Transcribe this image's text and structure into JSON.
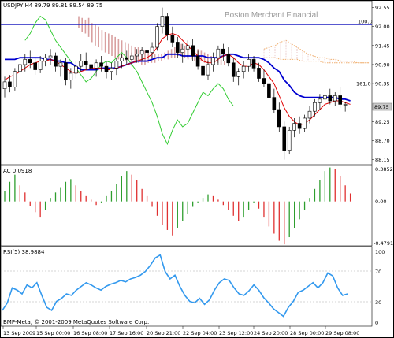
{
  "main": {
    "symbol_caption": "USDJPY,H4  89.79 89.81 89.54 89.75",
    "watermark": "Boston Merchant Financial",
    "current_price_label": "89.75",
    "price_ticks": [
      "92.55",
      "92.00",
      "91.45",
      "90.90",
      "90.35",
      "89.75",
      "89.25",
      "88.70",
      "88.15"
    ],
    "fib_labels": {
      "upper": "100.0",
      "lower": "161.0"
    },
    "colors": {
      "bull_candle": "#ffffff",
      "bear_candle": "#000000",
      "kijun": "#0000d0",
      "tenkan": "#e00000",
      "chikou": "#33cc33",
      "cloud": "#d9a0a0",
      "cloud_future": "#f0b070",
      "fib": "#2020c0"
    },
    "candles": [
      {
        "o": 90.2,
        "h": 90.55,
        "l": 89.95,
        "c": 90.4
      },
      {
        "o": 90.4,
        "h": 90.6,
        "l": 90.1,
        "c": 90.25
      },
      {
        "o": 90.25,
        "h": 90.8,
        "l": 90.15,
        "c": 90.7
      },
      {
        "o": 90.7,
        "h": 91.0,
        "l": 90.5,
        "c": 90.9
      },
      {
        "o": 90.9,
        "h": 91.2,
        "l": 90.7,
        "c": 91.05
      },
      {
        "o": 91.05,
        "h": 91.3,
        "l": 90.8,
        "c": 90.95
      },
      {
        "o": 90.95,
        "h": 91.1,
        "l": 90.6,
        "c": 90.75
      },
      {
        "o": 90.75,
        "h": 91.15,
        "l": 90.65,
        "c": 91.0
      },
      {
        "o": 91.0,
        "h": 91.2,
        "l": 90.85,
        "c": 91.1
      },
      {
        "o": 91.1,
        "h": 91.35,
        "l": 90.9,
        "c": 91.15
      },
      {
        "o": 91.15,
        "h": 91.25,
        "l": 90.7,
        "c": 90.85
      },
      {
        "o": 90.85,
        "h": 91.05,
        "l": 90.55,
        "c": 90.95
      },
      {
        "o": 90.95,
        "h": 91.1,
        "l": 90.3,
        "c": 90.45
      },
      {
        "o": 90.45,
        "h": 90.8,
        "l": 90.2,
        "c": 90.65
      },
      {
        "o": 90.65,
        "h": 91.0,
        "l": 90.5,
        "c": 90.85
      },
      {
        "o": 90.85,
        "h": 91.2,
        "l": 90.7,
        "c": 91.0
      },
      {
        "o": 91.0,
        "h": 91.25,
        "l": 90.75,
        "c": 90.9
      },
      {
        "o": 90.9,
        "h": 91.1,
        "l": 90.6,
        "c": 90.8
      },
      {
        "o": 90.8,
        "h": 91.05,
        "l": 90.55,
        "c": 90.95
      },
      {
        "o": 90.95,
        "h": 91.15,
        "l": 90.7,
        "c": 90.85
      },
      {
        "o": 90.85,
        "h": 91.0,
        "l": 90.5,
        "c": 90.7
      },
      {
        "o": 90.7,
        "h": 90.95,
        "l": 90.45,
        "c": 90.8
      },
      {
        "o": 90.8,
        "h": 91.1,
        "l": 90.6,
        "c": 91.0
      },
      {
        "o": 91.0,
        "h": 91.2,
        "l": 90.8,
        "c": 91.1
      },
      {
        "o": 91.1,
        "h": 91.3,
        "l": 90.9,
        "c": 91.05
      },
      {
        "o": 91.05,
        "h": 91.25,
        "l": 90.85,
        "c": 91.15
      },
      {
        "o": 91.15,
        "h": 91.35,
        "l": 90.95,
        "c": 91.2
      },
      {
        "o": 91.2,
        "h": 91.4,
        "l": 91.0,
        "c": 91.3
      },
      {
        "o": 91.3,
        "h": 91.5,
        "l": 91.05,
        "c": 91.25
      },
      {
        "o": 91.25,
        "h": 91.55,
        "l": 91.1,
        "c": 91.4
      },
      {
        "o": 91.4,
        "h": 92.1,
        "l": 91.3,
        "c": 92.0
      },
      {
        "o": 92.0,
        "h": 92.55,
        "l": 91.8,
        "c": 92.3
      },
      {
        "o": 92.3,
        "h": 92.4,
        "l": 91.6,
        "c": 91.75
      },
      {
        "o": 91.75,
        "h": 92.0,
        "l": 91.4,
        "c": 91.55
      },
      {
        "o": 91.55,
        "h": 91.7,
        "l": 91.1,
        "c": 91.25
      },
      {
        "o": 91.25,
        "h": 91.5,
        "l": 90.95,
        "c": 91.35
      },
      {
        "o": 91.35,
        "h": 91.6,
        "l": 91.1,
        "c": 91.45
      },
      {
        "o": 91.45,
        "h": 91.65,
        "l": 91.0,
        "c": 91.15
      },
      {
        "o": 91.15,
        "h": 91.3,
        "l": 90.75,
        "c": 90.85
      },
      {
        "o": 90.85,
        "h": 91.1,
        "l": 90.4,
        "c": 90.6
      },
      {
        "o": 90.6,
        "h": 91.0,
        "l": 90.45,
        "c": 90.9
      },
      {
        "o": 90.9,
        "h": 91.25,
        "l": 90.7,
        "c": 91.1
      },
      {
        "o": 91.1,
        "h": 91.45,
        "l": 90.9,
        "c": 91.35
      },
      {
        "o": 91.35,
        "h": 91.5,
        "l": 91.0,
        "c": 91.2
      },
      {
        "o": 91.2,
        "h": 91.4,
        "l": 90.85,
        "c": 90.95
      },
      {
        "o": 90.95,
        "h": 91.1,
        "l": 90.4,
        "c": 90.55
      },
      {
        "o": 90.55,
        "h": 90.8,
        "l": 90.3,
        "c": 90.7
      },
      {
        "o": 90.7,
        "h": 91.0,
        "l": 90.5,
        "c": 90.85
      },
      {
        "o": 90.85,
        "h": 91.2,
        "l": 90.7,
        "c": 91.05
      },
      {
        "o": 91.05,
        "h": 91.15,
        "l": 90.7,
        "c": 90.8
      },
      {
        "o": 90.8,
        "h": 90.95,
        "l": 90.4,
        "c": 90.5
      },
      {
        "o": 90.5,
        "h": 90.75,
        "l": 90.25,
        "c": 90.35
      },
      {
        "o": 90.35,
        "h": 90.5,
        "l": 89.85,
        "c": 89.95
      },
      {
        "o": 89.95,
        "h": 90.2,
        "l": 89.5,
        "c": 89.6
      },
      {
        "o": 89.6,
        "h": 89.8,
        "l": 88.95,
        "c": 89.1
      },
      {
        "o": 89.1,
        "h": 89.25,
        "l": 88.15,
        "c": 88.4
      },
      {
        "o": 88.4,
        "h": 89.1,
        "l": 88.3,
        "c": 89.0
      },
      {
        "o": 89.0,
        "h": 89.35,
        "l": 88.8,
        "c": 89.2
      },
      {
        "o": 89.2,
        "h": 89.4,
        "l": 88.9,
        "c": 89.05
      },
      {
        "o": 89.05,
        "h": 89.45,
        "l": 88.95,
        "c": 89.35
      },
      {
        "o": 89.35,
        "h": 89.7,
        "l": 89.2,
        "c": 89.55
      },
      {
        "o": 89.55,
        "h": 89.9,
        "l": 89.4,
        "c": 89.8
      },
      {
        "o": 89.8,
        "h": 90.05,
        "l": 89.6,
        "c": 89.9
      },
      {
        "o": 89.9,
        "h": 90.15,
        "l": 89.7,
        "c": 90.0
      },
      {
        "o": 90.0,
        "h": 90.2,
        "l": 89.75,
        "c": 89.85
      },
      {
        "o": 89.85,
        "h": 90.1,
        "l": 89.7,
        "c": 90.0
      },
      {
        "o": 90.0,
        "h": 90.25,
        "l": 89.65,
        "c": 89.75
      },
      {
        "o": 89.75,
        "h": 89.81,
        "l": 89.54,
        "c": 89.75
      }
    ],
    "kijun": [
      91.05,
      91.05,
      91.05,
      91.1,
      91.1,
      91.1,
      91.1,
      91.1,
      91.05,
      91.05,
      91.0,
      91.0,
      90.95,
      90.95,
      90.85,
      90.75,
      90.75,
      90.75,
      90.75,
      90.8,
      90.8,
      90.8,
      90.8,
      90.85,
      90.9,
      90.95,
      91.0,
      91.0,
      91.0,
      91.05,
      91.1,
      91.1,
      91.2,
      91.2,
      91.2,
      91.15,
      91.15,
      91.15,
      91.15,
      91.15,
      91.1,
      91.1,
      91.1,
      91.15,
      91.2,
      91.2,
      91.15,
      91.1,
      91.1,
      91.1,
      91.1,
      91.05,
      90.95,
      90.8,
      90.7,
      90.45,
      90.3,
      90.1,
      90.0,
      89.95,
      89.95,
      89.95,
      89.95,
      89.95,
      89.95,
      89.95,
      89.9,
      89.9,
      89.85
    ],
    "tenkan": [
      90.45,
      90.55,
      90.6,
      90.7,
      90.8,
      90.9,
      90.95,
      91.0,
      91.0,
      91.05,
      91.0,
      90.9,
      90.8,
      90.7,
      90.65,
      90.7,
      90.75,
      90.8,
      90.8,
      90.8,
      90.75,
      90.75,
      90.8,
      90.85,
      90.9,
      90.95,
      91.0,
      91.05,
      91.1,
      91.2,
      91.4,
      91.65,
      91.75,
      91.8,
      91.75,
      91.6,
      91.45,
      91.3,
      91.15,
      91.0,
      90.95,
      90.95,
      91.05,
      91.15,
      91.2,
      91.1,
      90.95,
      90.85,
      90.85,
      90.95,
      90.9,
      90.75,
      90.55,
      90.35,
      90.0,
      89.65,
      89.4,
      89.25,
      89.15,
      89.2,
      89.3,
      89.45,
      89.6,
      89.75,
      89.8,
      89.85,
      89.85,
      89.8,
      89.75
    ],
    "chikou": [
      91.6,
      91.8,
      92.1,
      92.3,
      92.2,
      91.9,
      91.6,
      91.4,
      91.2,
      91.0,
      90.8,
      90.6,
      90.4,
      90.5,
      90.7,
      90.9,
      91.0,
      90.95,
      91.1,
      91.25,
      91.1,
      90.9,
      90.7,
      90.4,
      90.1,
      89.8,
      89.4,
      88.9,
      88.6,
      89.0,
      89.3,
      89.1,
      89.2,
      89.5,
      89.8,
      90.1,
      90.0,
      90.2,
      90.35,
      90.2,
      89.9,
      89.7
    ],
    "cloud_top": [
      92.3,
      92.25,
      92.2,
      92.25,
      92.1,
      92.05,
      92.0,
      91.9,
      91.85,
      91.8,
      91.75,
      91.7,
      91.65,
      91.6,
      91.55,
      91.5,
      91.45,
      91.4,
      91.4,
      91.35,
      91.3,
      91.3,
      91.25,
      91.2,
      91.2,
      91.2,
      91.25,
      91.3,
      91.35,
      91.4,
      91.45,
      91.5,
      91.45,
      91.4,
      91.35,
      91.3,
      91.35,
      91.3,
      91.25,
      91.2,
      91.15,
      91.1,
      91.1,
      91.05,
      91.0
    ],
    "cloud_bottom": [
      91.95,
      91.85,
      91.8,
      91.7,
      91.55,
      91.45,
      91.4,
      91.3,
      91.25,
      91.2,
      91.15,
      91.1,
      91.05,
      91.05,
      91.0,
      91.0,
      90.95,
      90.95,
      90.95,
      90.9,
      90.9,
      90.95,
      90.95,
      90.95,
      91.0,
      91.0,
      91.05,
      91.05,
      91.1,
      91.1,
      91.15,
      91.15,
      91.1,
      91.05,
      91.05,
      91.0,
      91.0,
      91.0,
      90.95,
      90.95,
      90.95,
      90.95,
      90.95,
      90.9,
      90.9
    ],
    "cloud_future_a": [
      91.35,
      91.4,
      91.45,
      91.55,
      91.6,
      91.5,
      91.4,
      91.3,
      91.2,
      91.15,
      91.1,
      91.1,
      91.05,
      91.05,
      91.0,
      91.0,
      91.0,
      90.95,
      90.95,
      90.95
    ],
    "cloud_future_b": [
      91.1,
      91.1,
      91.1,
      91.05,
      91.05,
      91.05,
      91.05,
      91.0,
      91.0,
      91.0,
      91.0,
      90.95,
      90.95,
      90.95,
      90.95,
      90.95,
      90.95,
      90.95,
      90.95,
      90.95
    ]
  },
  "ac_panel": {
    "caption": "AC 0.0918",
    "ticks": [
      "0.3852",
      "0.00",
      "-0.4791"
    ],
    "colors": {
      "up": "#2e9e2e",
      "down": "#e03030"
    },
    "bars": [
      0.12,
      0.22,
      0.3,
      0.18,
      0.1,
      -0.05,
      -0.12,
      -0.18,
      -0.1,
      0.04,
      0.1,
      0.16,
      0.22,
      0.25,
      0.18,
      0.12,
      0.06,
      0.02,
      -0.04,
      -0.02,
      0.06,
      0.12,
      0.2,
      0.28,
      0.34,
      0.3,
      0.24,
      0.14,
      0.06,
      -0.06,
      -0.16,
      -0.26,
      -0.32,
      -0.38,
      -0.3,
      -0.22,
      -0.14,
      -0.06,
      -0.02,
      0.04,
      0.08,
      0.06,
      0.02,
      -0.04,
      -0.1,
      -0.16,
      -0.22,
      -0.18,
      -0.1,
      -0.02,
      -0.08,
      -0.18,
      -0.28,
      -0.36,
      -0.44,
      -0.48,
      -0.4,
      -0.3,
      -0.2,
      -0.1,
      0.04,
      0.14,
      0.24,
      0.34,
      0.38,
      0.36,
      0.28,
      0.18,
      0.09
    ]
  },
  "rsi_panel": {
    "caption": "RSI(5) 38.9884",
    "ticks": [
      "100",
      "70",
      "30",
      "0"
    ],
    "line_color": "#3399ee",
    "values": [
      18,
      28,
      48,
      45,
      40,
      52,
      48,
      55,
      38,
      22,
      18,
      30,
      34,
      40,
      38,
      45,
      50,
      55,
      52,
      48,
      45,
      50,
      53,
      55,
      58,
      56,
      60,
      62,
      65,
      70,
      78,
      88,
      92,
      70,
      60,
      65,
      50,
      38,
      30,
      28,
      34,
      26,
      32,
      45,
      55,
      60,
      58,
      48,
      40,
      38,
      44,
      52,
      45,
      35,
      28,
      20,
      15,
      10,
      22,
      30,
      42,
      45,
      50,
      55,
      48,
      55,
      68,
      64,
      48,
      38,
      40
    ],
    "footer": "BMP-Meta, © 2001-2009 MetaQuotes Software Corp."
  },
  "time_axis": [
    "13 Sep 2009",
    "15 Sep 00:00",
    "16 Sep 08:00",
    "17 Sep 16:00",
    "20 Sep 21:00",
    "22 Sep 04:00",
    "23 Sep 12:00",
    "24 Sep 20:00",
    "28 Sep 00:00",
    "29 Sep 08:00"
  ]
}
